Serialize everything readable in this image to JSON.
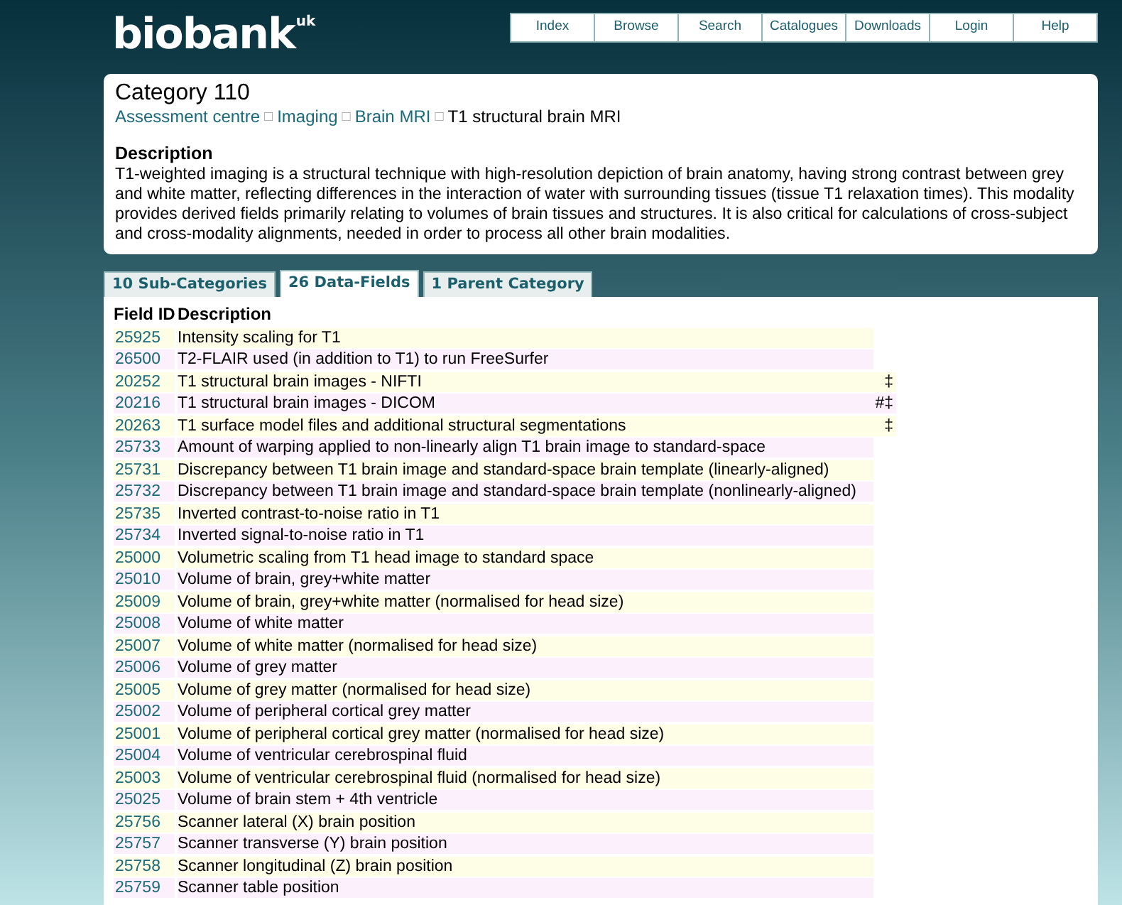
{
  "logo": {
    "text": "biobank",
    "superscript": "uk"
  },
  "nav": [
    "Index",
    "Browse",
    "Search",
    "Catalogues",
    "Downloads",
    "Login",
    "Help"
  ],
  "category": {
    "title": "Category 110",
    "breadcrumb": [
      {
        "label": "Assessment centre",
        "link": true
      },
      {
        "label": "Imaging",
        "link": true
      },
      {
        "label": "Brain MRI",
        "link": true
      },
      {
        "label": "T1 structural brain MRI",
        "link": false
      }
    ],
    "separator": "□"
  },
  "description": {
    "heading": "Description",
    "text": "T1-weighted imaging is a structural technique with high-resolution depiction of brain anatomy, having strong contrast between grey and white matter, reflecting differences in the interaction of water with surrounding tissues (tissue T1 relaxation times). This modality provides derived fields primarily relating to volumes of brain tissues and structures. It is also critical for calculations of cross-subject and cross-modality alignments, needed in order to process all other brain modalities."
  },
  "tabs": [
    {
      "label": "10 Sub-Categories",
      "selected": false
    },
    {
      "label": "26 Data-Fields",
      "selected": true
    },
    {
      "label": "1 Parent Category",
      "selected": false
    }
  ],
  "table": {
    "columns": [
      "Field ID",
      "Description"
    ],
    "rows": [
      {
        "id": "25925",
        "description": "Intensity scaling for T1"
      },
      {
        "id": "26500",
        "description": "T2-FLAIR used (in addition to T1) to run FreeSurfer"
      },
      {
        "id": "20252",
        "description": "T1 structural brain images - NIFTI",
        "note": "‡"
      },
      {
        "id": "20216",
        "description": "T1 structural brain images - DICOM",
        "note": "#‡"
      },
      {
        "id": "20263",
        "description": "T1 surface model files and additional structural segmentations",
        "note": "‡"
      },
      {
        "id": "25733",
        "description": "Amount of warping applied to non-linearly align T1 brain image to standard-space"
      },
      {
        "id": "25731",
        "description": "Discrepancy between T1 brain image and standard-space brain template (linearly-aligned)"
      },
      {
        "id": "25732",
        "description": "Discrepancy between T1 brain image and standard-space brain template (nonlinearly-aligned)"
      },
      {
        "id": "25735",
        "description": "Inverted contrast-to-noise ratio in T1"
      },
      {
        "id": "25734",
        "description": "Inverted signal-to-noise ratio in T1"
      },
      {
        "id": "25000",
        "description": "Volumetric scaling from T1 head image to standard space"
      },
      {
        "id": "25010",
        "description": "Volume of brain, grey+white matter"
      },
      {
        "id": "25009",
        "description": "Volume of brain, grey+white matter (normalised for head size)"
      },
      {
        "id": "25008",
        "description": "Volume of white matter"
      },
      {
        "id": "25007",
        "description": "Volume of white matter (normalised for head size)"
      },
      {
        "id": "25006",
        "description": "Volume of grey matter"
      },
      {
        "id": "25005",
        "description": "Volume of grey matter (normalised for head size)"
      },
      {
        "id": "25002",
        "description": "Volume of peripheral cortical grey matter"
      },
      {
        "id": "25001",
        "description": "Volume of peripheral cortical grey matter (normalised for head size)"
      },
      {
        "id": "25004",
        "description": "Volume of ventricular cerebrospinal fluid"
      },
      {
        "id": "25003",
        "description": "Volume of ventricular cerebrospinal fluid (normalised for head size)"
      },
      {
        "id": "25025",
        "description": "Volume of brain stem + 4th ventricle"
      },
      {
        "id": "25756",
        "description": "Scanner lateral (X) brain position"
      },
      {
        "id": "25757",
        "description": "Scanner transverse (Y) brain position"
      },
      {
        "id": "25758",
        "description": "Scanner longitudinal (Z) brain position"
      },
      {
        "id": "25759",
        "description": "Scanner table position"
      }
    ]
  }
}
